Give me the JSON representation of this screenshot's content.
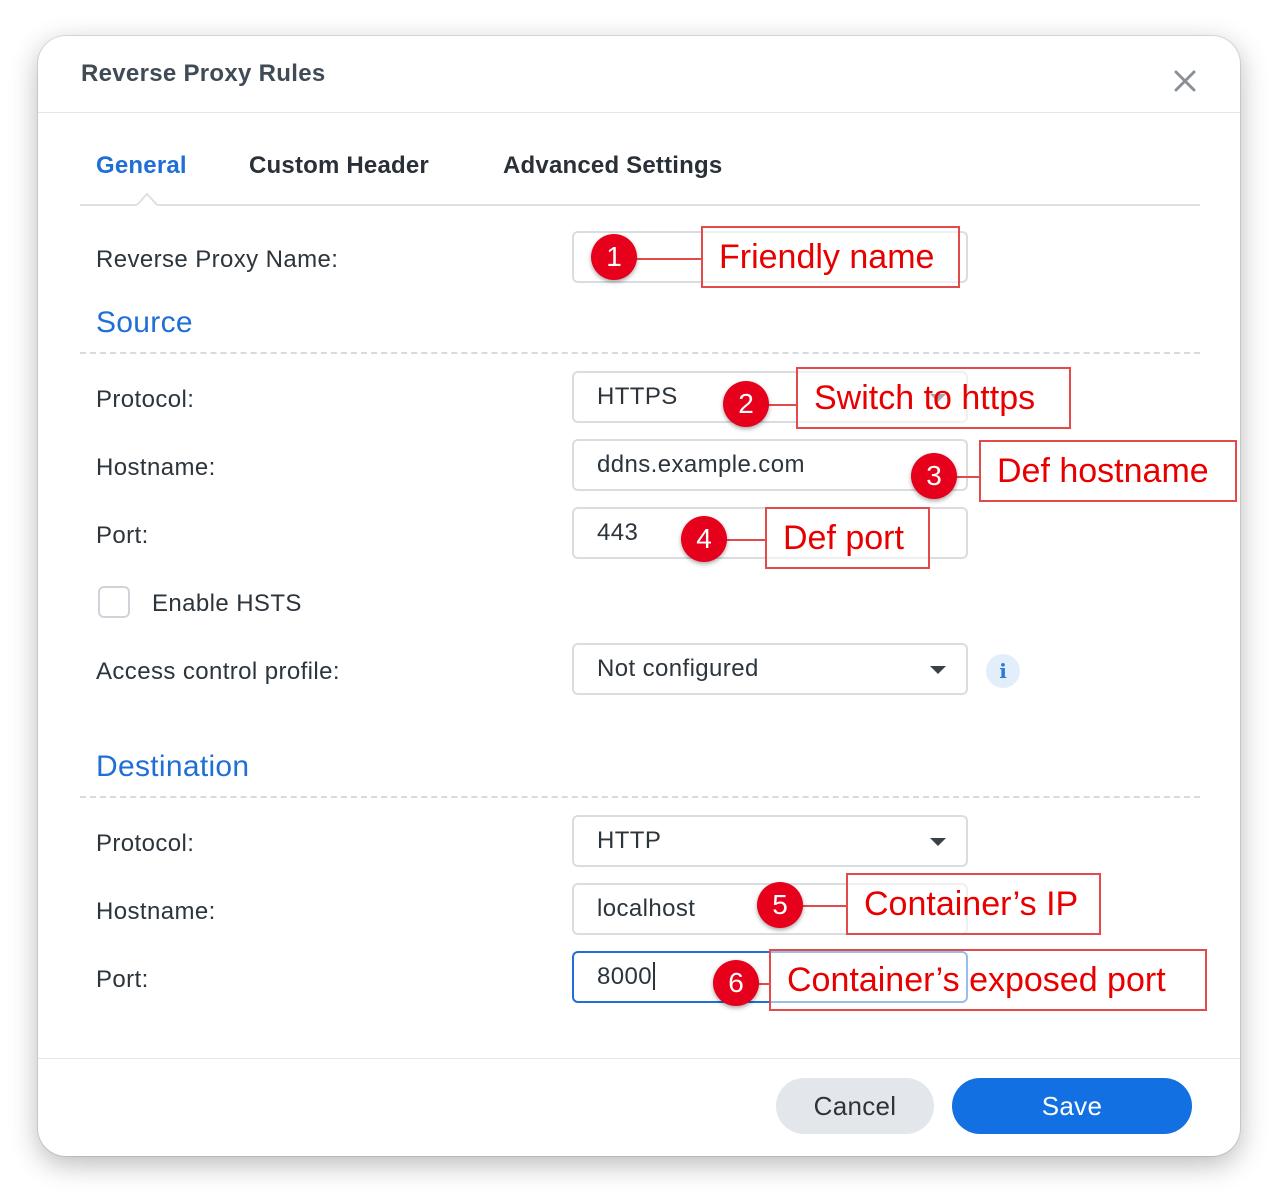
{
  "dialog": {
    "title": "Reverse Proxy Rules",
    "tabs": [
      {
        "label": "General",
        "active": true
      },
      {
        "label": "Custom Header",
        "active": false
      },
      {
        "label": "Advanced Settings",
        "active": false
      }
    ],
    "name_label": "Reverse Proxy Name:",
    "name_value": ""
  },
  "source": {
    "heading": "Source",
    "protocol_label": "Protocol:",
    "protocol_value": "HTTPS",
    "hostname_label": "Hostname:",
    "hostname_value": "ddns.example.com",
    "port_label": "Port:",
    "port_value": "443",
    "hsts_label": "Enable HSTS",
    "hsts_checked": false,
    "acl_label": "Access control profile:",
    "acl_value": "Not configured"
  },
  "destination": {
    "heading": "Destination",
    "protocol_label": "Protocol:",
    "protocol_value": "HTTP",
    "hostname_label": "Hostname:",
    "hostname_value": "localhost",
    "port_label": "Port:",
    "port_value": "8000"
  },
  "footer": {
    "cancel_label": "Cancel",
    "save_label": "Save"
  },
  "annotations": [
    {
      "number": "1",
      "text": "Friendly name"
    },
    {
      "number": "2",
      "text": "Switch to https"
    },
    {
      "number": "3",
      "text": "Def hostname"
    },
    {
      "number": "4",
      "text": "Def port"
    },
    {
      "number": "5",
      "text": "Container’s IP"
    },
    {
      "number": "6",
      "text": "Container’s exposed port"
    }
  ],
  "colors": {
    "accent": "#1f6fd6",
    "save_button": "#1270e2",
    "annotation": "#e6001c"
  },
  "icons": [
    "close-icon",
    "dropdown-arrow-icon",
    "info-icon"
  ]
}
